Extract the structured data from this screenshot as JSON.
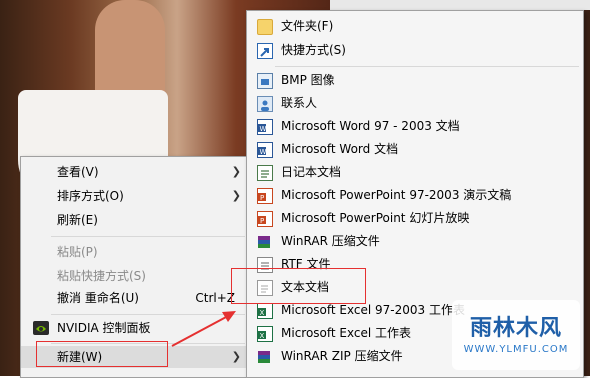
{
  "context_menu": {
    "items": [
      {
        "label": "查看(V)",
        "disabled": false
      },
      {
        "label": "排序方式(O)",
        "disabled": false
      },
      {
        "label": "刷新(E)",
        "disabled": false
      },
      {
        "label": "粘贴(P)",
        "disabled": true
      },
      {
        "label": "粘贴快捷方式(S)",
        "disabled": true
      },
      {
        "label": "撤消 重命名(U)",
        "shortcut": "Ctrl+Z",
        "disabled": false
      },
      {
        "label": "NVIDIA 控制面板",
        "disabled": false
      },
      {
        "label": "新建(W)",
        "disabled": false
      }
    ]
  },
  "new_submenu": {
    "items": [
      {
        "label": "文件夹(F)",
        "icon": "folder-icon"
      },
      {
        "label": "快捷方式(S)",
        "icon": "shortcut-icon"
      },
      {
        "label": "BMP 图像",
        "icon": "bmp-icon"
      },
      {
        "label": "联系人",
        "icon": "contact-icon"
      },
      {
        "label": "Microsoft Word 97 - 2003 文档",
        "icon": "word-icon"
      },
      {
        "label": "Microsoft Word 文档",
        "icon": "word-icon"
      },
      {
        "label": "日记本文档",
        "icon": "journal-icon"
      },
      {
        "label": "Microsoft PowerPoint 97-2003 演示文稿",
        "icon": "powerpoint-icon"
      },
      {
        "label": "Microsoft PowerPoint 幻灯片放映",
        "icon": "powerpoint-icon"
      },
      {
        "label": "WinRAR 压缩文件",
        "icon": "winrar-icon"
      },
      {
        "label": "RTF 文件",
        "icon": "rtf-icon"
      },
      {
        "label": "文本文档",
        "icon": "text-document-icon"
      },
      {
        "label": "Microsoft Excel 97-2003 工作表",
        "icon": "excel-icon"
      },
      {
        "label": "Microsoft Excel 工作表",
        "icon": "excel-icon"
      },
      {
        "label": "WinRAR ZIP 压缩文件",
        "icon": "winrar-zip-icon"
      }
    ]
  },
  "watermark": {
    "title": "雨林木风",
    "url": "WWW.YLMFU.COM"
  },
  "colors": {
    "annotation_red": "#e53030",
    "menu_bg": "#f2f2f2",
    "highlight": "#dcdcdc"
  }
}
